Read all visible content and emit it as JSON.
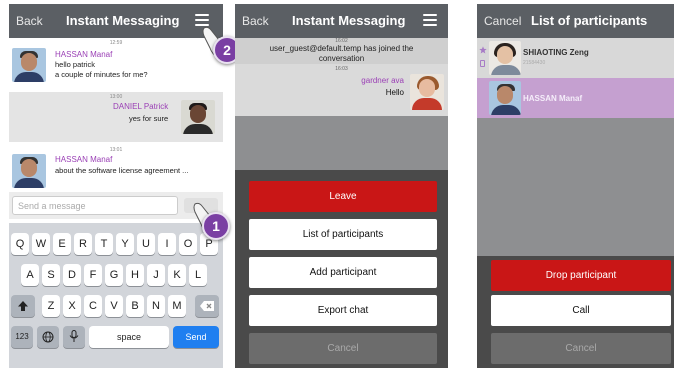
{
  "screen1": {
    "nav": {
      "back": "Back",
      "title": "Instant Messaging"
    },
    "messages": [
      {
        "time": "12:59",
        "name": "HASSAN Manaf",
        "line1": "hello patrick",
        "line2": "a couple of minutes for me?"
      },
      {
        "time": "13:00",
        "name": "DANIEL Patrick",
        "line1": "yes for sure"
      },
      {
        "time": "13:01",
        "name": "HASSAN Manaf",
        "line1": "about the software license agreement ..."
      }
    ],
    "input_placeholder": "Send a message",
    "keyboard": {
      "row1": [
        "Q",
        "W",
        "E",
        "R",
        "T",
        "Y",
        "U",
        "I",
        "O",
        "P"
      ],
      "row2": [
        "A",
        "S",
        "D",
        "F",
        "G",
        "H",
        "J",
        "K",
        "L"
      ],
      "row3": [
        "Z",
        "X",
        "C",
        "V",
        "B",
        "N",
        "M"
      ],
      "numbers": "123",
      "space": "space",
      "send": "Send"
    },
    "callouts": [
      "1",
      "2"
    ]
  },
  "screen2": {
    "nav": {
      "back": "Back",
      "title": "Instant Messaging"
    },
    "system_time": "16:02",
    "system_line1": "user_guest@default.temp has joined the",
    "system_line2": "conversation",
    "reply_time": "16:03",
    "reply_name": "gardner ava",
    "reply_text": "Hello",
    "buttons": {
      "leave": "Leave",
      "list": "List of participants",
      "add": "Add participant",
      "export": "Export chat",
      "cancel": "Cancel"
    }
  },
  "screen3": {
    "nav": {
      "back": "Cancel",
      "title": "List of participants"
    },
    "participants": [
      {
        "name": "SHIAOTING Zeng",
        "sub": "21584430"
      },
      {
        "name": "HASSAN Manaf"
      }
    ],
    "buttons": {
      "drop": "Drop participant",
      "call": "Call",
      "cancel": "Cancel"
    }
  },
  "colors": {
    "navbar": "#5b5f64",
    "accent_purple": "#9a3fb5",
    "leave_red": "#c91616",
    "send_blue": "#1f7ff0",
    "selected_row": "#c5a0d0"
  },
  "icons": [
    "menu-icon",
    "globe-icon",
    "microphone-icon",
    "shift-icon",
    "delete-icon",
    "star-icon",
    "finger-pointer-icon"
  ]
}
